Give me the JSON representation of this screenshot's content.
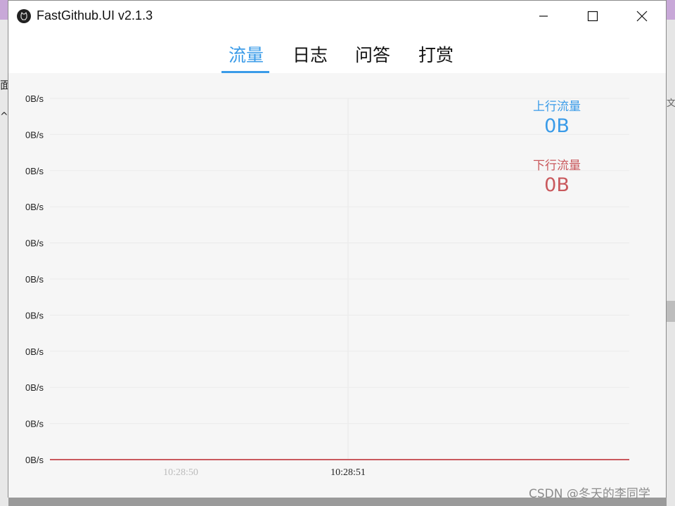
{
  "window": {
    "title": "FastGithub.UI v2.1.3",
    "controls": {
      "minimize": "minimize",
      "maximize": "maximize",
      "close": "close"
    }
  },
  "tabs": [
    {
      "label": "流量",
      "active": true
    },
    {
      "label": "日志",
      "active": false
    },
    {
      "label": "问答",
      "active": false
    },
    {
      "label": "打赏",
      "active": false
    }
  ],
  "stats": {
    "upload_label": "上行流量",
    "upload_value": "0B",
    "download_label": "下行流量",
    "download_value": "0B"
  },
  "chart_data": {
    "type": "line",
    "y_tick_labels": [
      "0B/s",
      "0B/s",
      "0B/s",
      "0B/s",
      "0B/s",
      "0B/s",
      "0B/s",
      "0B/s",
      "0B/s",
      "0B/s",
      "0B/s"
    ],
    "x_tick_labels": [
      {
        "label": "10:28:50",
        "faded": true
      },
      {
        "label": "10:28:51",
        "faded": false
      }
    ],
    "series": [
      {
        "values": [
          0,
          0
        ],
        "color": "#3a9be8"
      },
      {
        "values": [
          0,
          0
        ],
        "color": "#c9595d"
      }
    ],
    "grid": true
  },
  "colors": {
    "accent": "#3a9be8",
    "download": "#c9595d"
  },
  "watermark": "CSDN @冬天的李同学",
  "background": {
    "left_fragment_1": "面",
    "left_fragment_2": "^",
    "right_fragment": "文"
  }
}
